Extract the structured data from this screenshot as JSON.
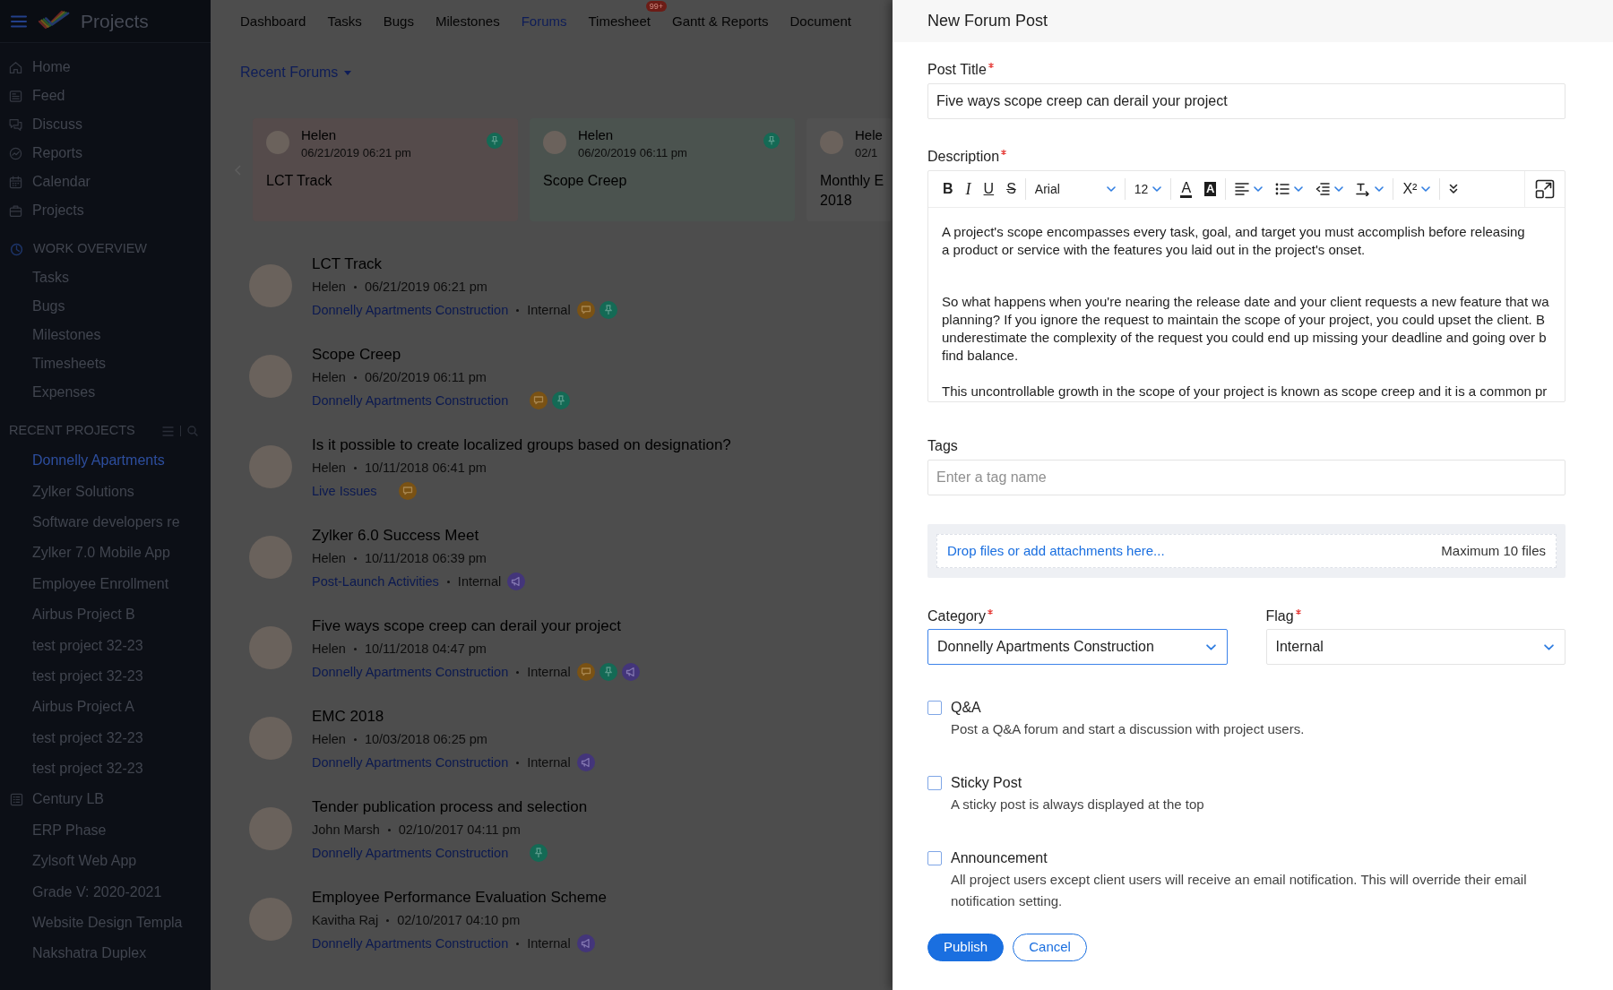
{
  "sidebar": {
    "app_title": "Projects",
    "nav": [
      {
        "kind": "home",
        "label": "Home"
      },
      {
        "kind": "feed",
        "label": "Feed"
      },
      {
        "kind": "discuss",
        "label": "Discuss"
      },
      {
        "kind": "reports",
        "label": "Reports"
      },
      {
        "kind": "calendar",
        "label": "Calendar"
      },
      {
        "kind": "projects",
        "label": "Projects"
      }
    ],
    "work_overview": {
      "heading": "WORK OVERVIEW",
      "items": [
        "Tasks",
        "Bugs",
        "Milestones",
        "Timesheets",
        "Expenses"
      ]
    },
    "recent_projects": {
      "heading": "RECENT PROJECTS",
      "items": [
        {
          "label": "Donnelly Apartments",
          "kind": "project",
          "selected": true
        },
        {
          "label": "Zylker Solutions",
          "kind": "project",
          "selected": false
        },
        {
          "label": "Software developers re",
          "kind": "project",
          "selected": false
        },
        {
          "label": "Zylker 7.0 Mobile App",
          "kind": "project",
          "selected": false
        },
        {
          "label": "Employee Enrollment",
          "kind": "project",
          "selected": false
        },
        {
          "label": "Airbus Project B",
          "kind": "project",
          "selected": false
        },
        {
          "label": "test project 32-23",
          "kind": "project",
          "selected": false
        },
        {
          "label": "test project 32-23",
          "kind": "project",
          "selected": false
        },
        {
          "label": "Airbus Project A",
          "kind": "project",
          "selected": false
        },
        {
          "label": "test project 32-23",
          "kind": "project",
          "selected": false
        },
        {
          "label": "test project 32-23",
          "kind": "project",
          "selected": false
        },
        {
          "label": "Century LB",
          "kind": "group",
          "selected": false
        },
        {
          "label": "ERP Phase",
          "kind": "project",
          "selected": false
        },
        {
          "label": "Zylsoft Web App",
          "kind": "project",
          "selected": false
        },
        {
          "label": "Grade V: 2020-2021",
          "kind": "project",
          "selected": false
        },
        {
          "label": "Website Design Templa",
          "kind": "project",
          "selected": false
        },
        {
          "label": "Nakshatra Duplex",
          "kind": "project",
          "selected": false
        }
      ]
    }
  },
  "top_nav": {
    "tabs": [
      {
        "label": "Dashboard",
        "selected": false
      },
      {
        "label": "Tasks",
        "selected": false
      },
      {
        "label": "Bugs",
        "selected": false
      },
      {
        "label": "Milestones",
        "selected": false
      },
      {
        "label": "Forums",
        "selected": true
      },
      {
        "label": "Timesheet",
        "selected": false,
        "badge": "99+"
      },
      {
        "label": "Gantt & Reports",
        "selected": false
      },
      {
        "label": "Document",
        "selected": false
      }
    ]
  },
  "recent_forums": {
    "label": "Recent Forums",
    "cards": [
      {
        "author": "Helen",
        "date": "06/21/2019 06:21 pm",
        "title": "LCT Track",
        "sticky": true,
        "color": "#554b4b"
      },
      {
        "author": "Helen",
        "date": "06/20/2019 06:11 pm",
        "title": "Scope Creep",
        "sticky": true,
        "color": "#4b534f"
      },
      {
        "author": "Hele",
        "date": "02/1",
        "title": "Monthly E 2018",
        "sticky": false,
        "color": "#515151"
      }
    ]
  },
  "forums": [
    {
      "title": "LCT Track",
      "author": "Helen",
      "date": "06/21/2019 06:21 pm",
      "project": "Donnelly Apartments Construction",
      "flag": "Internal",
      "qa": true,
      "sticky": true,
      "announcement": false
    },
    {
      "title": "Scope Creep",
      "author": "Helen",
      "date": "06/20/2019 06:11 pm",
      "project": "Donnelly Apartments Construction",
      "qa": true,
      "sticky": true,
      "announcement": false
    },
    {
      "title": "Is it possible to create localized groups based on designation?",
      "author": "Helen",
      "date": "10/11/2018 06:41 pm",
      "project": "Live Issues",
      "qa": true,
      "sticky": false,
      "announcement": false
    },
    {
      "title": "Zylker 6.0 Success Meet",
      "author": "Helen",
      "date": "10/11/2018 06:39 pm",
      "project": "Post-Launch Activities",
      "flag": "Internal",
      "qa": false,
      "sticky": false,
      "announcement": true
    },
    {
      "title": "Five ways scope creep can derail your project",
      "author": "Helen",
      "date": "10/11/2018 04:47 pm",
      "project": "Donnelly Apartments Construction",
      "flag": "Internal",
      "qa": true,
      "sticky": true,
      "announcement": true
    },
    {
      "title": "EMC 2018",
      "author": "Helen",
      "date": "10/03/2018 06:25 pm",
      "project": "Donnelly Apartments Construction",
      "flag": "Internal",
      "qa": false,
      "sticky": false,
      "announcement": true
    },
    {
      "title": "Tender publication process and selection",
      "author": "John Marsh",
      "date": "02/10/2017 04:11 pm",
      "project": "Donnelly Apartments Construction",
      "qa": false,
      "sticky": true,
      "announcement": false
    },
    {
      "title": "Employee Performance Evaluation Scheme",
      "author": "Kavitha Raj",
      "date": "02/10/2017 04:10 pm",
      "project": "Donnelly Apartments Construction",
      "flag": "Internal",
      "qa": false,
      "sticky": false,
      "announcement": true
    }
  ],
  "form": {
    "title": "New Forum Post",
    "post_title": {
      "label": "Post Title",
      "required": true,
      "value": "Five ways scope creep can derail your project"
    },
    "description": {
      "label": "Description",
      "required": true,
      "toolbar": [
        [
          {
            "kind": "bold",
            "label": "B"
          },
          {
            "kind": "italic",
            "label": "I"
          },
          {
            "kind": "underline",
            "label": "U"
          },
          {
            "kind": "strike",
            "label": "S"
          }
        ],
        [
          {
            "kind": "font",
            "label": "Arial",
            "dropdown": true
          }
        ],
        [
          {
            "kind": "size",
            "label": "12",
            "dropdown": true
          }
        ],
        [
          {
            "kind": "color",
            "label": "A"
          },
          {
            "kind": "highlight",
            "label": "A"
          }
        ],
        [
          {
            "kind": "align",
            "dropdown": true
          },
          {
            "kind": "bullets",
            "dropdown": true
          },
          {
            "kind": "outdent",
            "dropdown": true
          },
          {
            "kind": "direction",
            "dropdown": true
          }
        ],
        [
          {
            "kind": "script",
            "label": "X²",
            "dropdown": true
          }
        ],
        [
          {
            "kind": "more"
          }
        ]
      ],
      "paragraphs": [
        {
          "lines": [
            "A project's scope encompasses every task, goal, and target you must accomplish before releasing",
            "a product or service with the features you laid out in the project's onset."
          ]
        },
        {
          "lines": [
            "So what happens when you're nearing the release date and your client requests a new feature that wa",
            "planning? If you ignore the request to maintain the scope of your project, you could upset the client. B",
            "underestimate the complexity of the request you could end up missing your deadline and going over b",
            "find balance."
          ]
        },
        {
          "lines": [
            "This uncontrollable growth in the scope of your project is known as scope creep and it is a common pr"
          ]
        }
      ]
    },
    "tags": {
      "label": "Tags",
      "required": false,
      "placeholder": "Enter a tag name"
    },
    "attachments": {
      "link": "Drop files or add attachments here...",
      "limit": "Maximum 10 files"
    },
    "category": {
      "label": "Category",
      "required": true,
      "value": "Donnelly Apartments Construction",
      "focused": true
    },
    "flag": {
      "label": "Flag",
      "required": true,
      "value": "Internal",
      "focused": false
    },
    "options": [
      {
        "label": "Q&A",
        "description": "Post a Q&A forum and start a discussion with project users.",
        "checked": false
      },
      {
        "label": "Sticky Post",
        "description": "A sticky post is always displayed at the top",
        "checked": false
      },
      {
        "label": "Announcement",
        "description": "All project users except client users will receive an email notification. This will override their email notification setting.",
        "checked": false
      }
    ],
    "buttons": [
      {
        "kind": "primary",
        "label": "Publish"
      },
      {
        "kind": "secondary",
        "label": "Cancel"
      }
    ]
  }
}
